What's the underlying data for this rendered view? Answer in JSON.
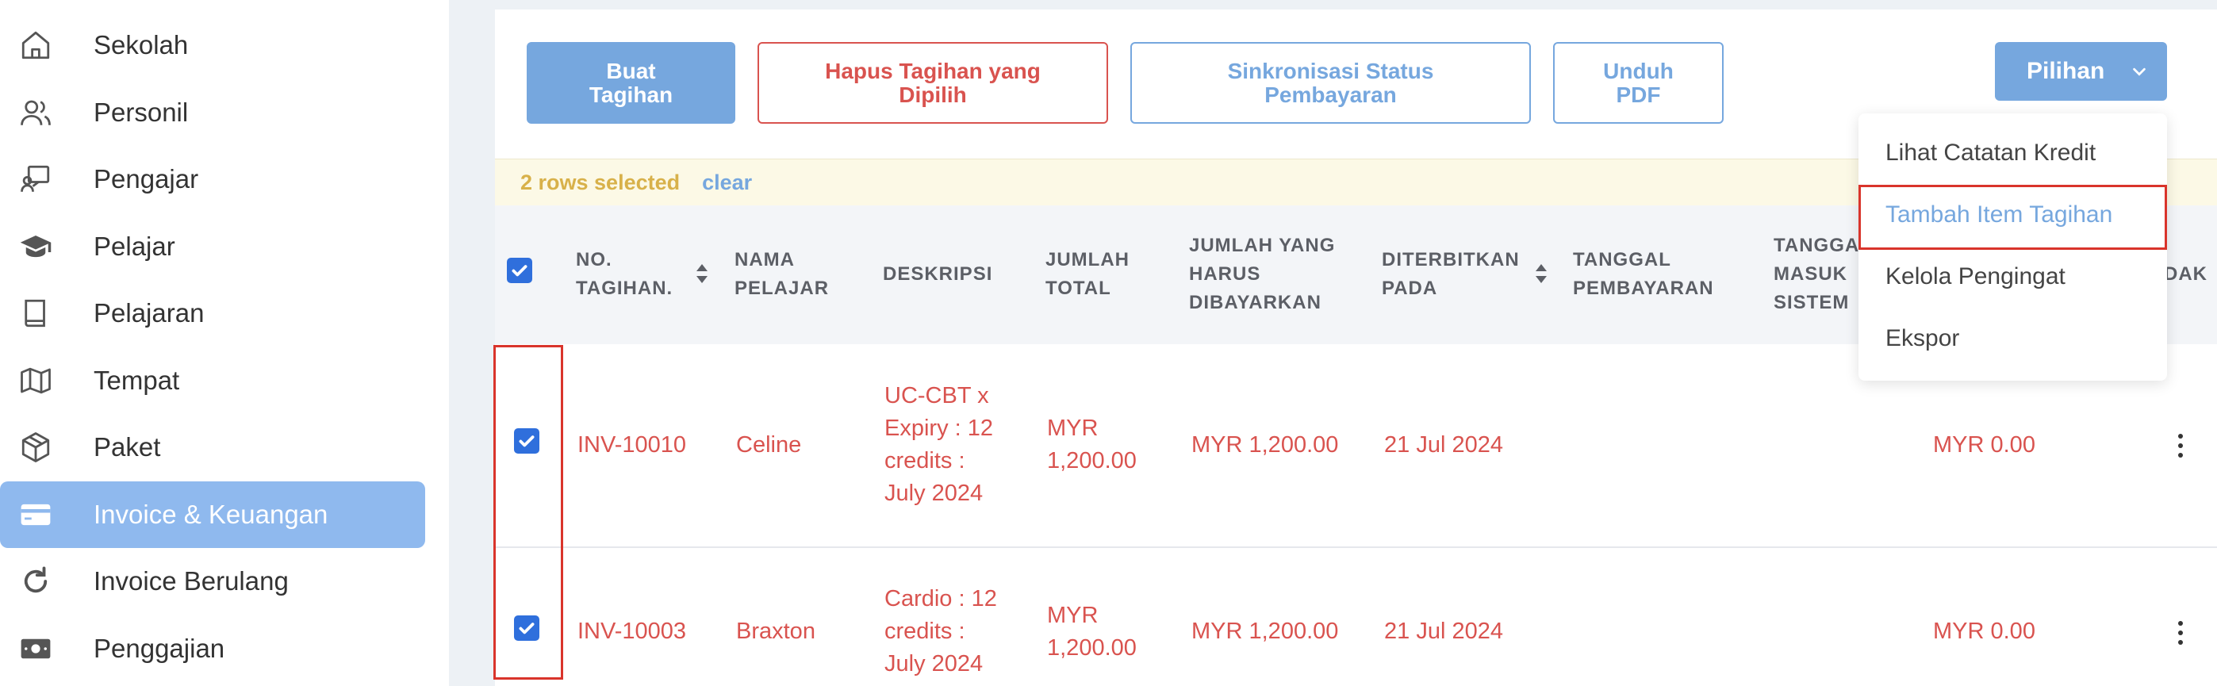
{
  "sidebar": {
    "items": [
      {
        "label": "Sekolah",
        "icon": "home-icon"
      },
      {
        "label": "Personil",
        "icon": "users-icon"
      },
      {
        "label": "Pengajar",
        "icon": "teacher-icon"
      },
      {
        "label": "Pelajar",
        "icon": "graduation-cap-icon"
      },
      {
        "label": "Pelajaran",
        "icon": "book-icon"
      },
      {
        "label": "Tempat",
        "icon": "map-icon"
      },
      {
        "label": "Paket",
        "icon": "package-icon"
      },
      {
        "label": "Invoice & Keuangan",
        "icon": "credit-card-icon",
        "active": true
      },
      {
        "label": "Invoice Berulang",
        "icon": "refresh-icon"
      },
      {
        "label": "Penggajian",
        "icon": "money-icon"
      }
    ]
  },
  "toolbar": {
    "create_label": "Buat Tagihan",
    "delete_label": "Hapus Tagihan yang Dipilih",
    "sync_label": "Sinkronisasi Status Pembayaran",
    "pdf_label": "Unduh PDF",
    "options_label": "Pilihan"
  },
  "selection": {
    "count_text": "2 rows selected",
    "clear_label": "clear"
  },
  "table": {
    "headers": {
      "invoice_no": "NO. TAGIHAN.",
      "student_name": "NAMA PELAJAR",
      "description": "DESKRIPSI",
      "total": "JUMLAH TOTAL",
      "amount_due": "JUMLAH YANG HARUS DIBAYARKAN",
      "issued_on": "DITERBITKAN PADA",
      "payment_date": "TANGGAL PEMBAYARAN",
      "entered_date": "TANGGA MASUK SISTEM",
      "cut_col": "DAK"
    },
    "rows": [
      {
        "invoice_no": "INV-10010",
        "student": "Celine",
        "description": "UC-CBT x Expiry : 12 credits : July 2024",
        "total": "MYR 1,200.00",
        "amount_due": "MYR 1,200.00",
        "issued_on": "21 Jul 2024",
        "paid": "MYR 0.00",
        "checked": true
      },
      {
        "invoice_no": "INV-10003",
        "student": "Braxton",
        "description": "Cardio : 12 credits : July 2024",
        "total": "MYR 1,200.00",
        "amount_due": "MYR 1,200.00",
        "issued_on": "21 Jul 2024",
        "paid": "MYR 0.00",
        "checked": true
      }
    ]
  },
  "options_menu": {
    "items": [
      "Lihat Catatan Kredit",
      "Tambah Item Tagihan",
      "Kelola Pengingat",
      "Ekspor"
    ],
    "highlighted": "Tambah Item Tagihan"
  },
  "colors": {
    "accent": "#76a7de",
    "danger": "#d9534f",
    "checkbox": "#2f6fdc",
    "annotation": "#d9342b"
  }
}
